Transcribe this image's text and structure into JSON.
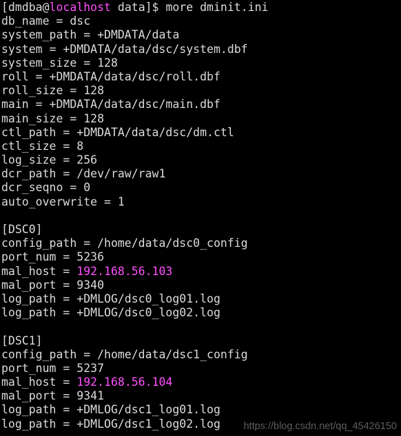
{
  "terminal": {
    "background_color": "#000000",
    "foreground_color": "#dcdcdc",
    "accent_color": "#ff50ff",
    "prompt": {
      "user_host_open": "[dmdba@",
      "host": "localhost",
      "path_close": " data]$ ",
      "command": "more dminit.ini"
    },
    "lines": [
      {
        "name": "prompt-line",
        "type": "prompt"
      },
      {
        "name": "line-db-name",
        "type": "plain",
        "text": "db_name = dsc"
      },
      {
        "name": "line-system-path",
        "type": "plain",
        "text": "system_path = +DMDATA/data"
      },
      {
        "name": "line-system",
        "type": "plain",
        "text": "system = +DMDATA/data/dsc/system.dbf"
      },
      {
        "name": "line-system-size",
        "type": "plain",
        "text": "system_size = 128"
      },
      {
        "name": "line-roll",
        "type": "plain",
        "text": "roll = +DMDATA/data/dsc/roll.dbf"
      },
      {
        "name": "line-roll-size",
        "type": "plain",
        "text": "roll_size = 128"
      },
      {
        "name": "line-main",
        "type": "plain",
        "text": "main = +DMDATA/data/dsc/main.dbf"
      },
      {
        "name": "line-main-size",
        "type": "plain",
        "text": "main_size = 128"
      },
      {
        "name": "line-ctl-path",
        "type": "plain",
        "text": "ctl_path = +DMDATA/data/dsc/dm.ctl"
      },
      {
        "name": "line-ctl-size",
        "type": "plain",
        "text": "ctl_size = 8"
      },
      {
        "name": "line-log-size",
        "type": "plain",
        "text": "log_size = 256"
      },
      {
        "name": "line-dcr-path",
        "type": "plain",
        "text": "dcr_path = /dev/raw/raw1"
      },
      {
        "name": "line-dcr-seqno",
        "type": "plain",
        "text": "dcr_seqno = 0"
      },
      {
        "name": "line-auto-overwrite",
        "type": "plain",
        "text": "auto_overwrite = 1"
      },
      {
        "name": "line-blank-1",
        "type": "blank",
        "text": ""
      },
      {
        "name": "section-header-dsc0",
        "type": "plain",
        "text": "[DSC0]"
      },
      {
        "name": "line-dsc0-config-path",
        "type": "plain",
        "text": "config_path = /home/data/dsc0_config"
      },
      {
        "name": "line-dsc0-port-num",
        "type": "plain",
        "text": "port_num = 5236"
      },
      {
        "name": "line-dsc0-mal-host",
        "type": "keyvalue",
        "prefix": "mal_host = ",
        "value": "192.168.56.103"
      },
      {
        "name": "line-dsc0-mal-port",
        "type": "plain",
        "text": "mal_port = 9340"
      },
      {
        "name": "line-dsc0-log-path-01",
        "type": "plain",
        "text": "log_path = +DMLOG/dsc0_log01.log"
      },
      {
        "name": "line-dsc0-log-path-02",
        "type": "plain",
        "text": "log_path = +DMLOG/dsc0_log02.log"
      },
      {
        "name": "line-blank-2",
        "type": "blank",
        "text": ""
      },
      {
        "name": "section-header-dsc1",
        "type": "plain",
        "text": "[DSC1]"
      },
      {
        "name": "line-dsc1-config-path",
        "type": "plain",
        "text": "config_path = /home/data/dsc1_config"
      },
      {
        "name": "line-dsc1-port-num",
        "type": "plain",
        "text": "port_num = 5237"
      },
      {
        "name": "line-dsc1-mal-host",
        "type": "keyvalue",
        "prefix": "mal_host = ",
        "value": "192.168.56.104"
      },
      {
        "name": "line-dsc1-mal-port",
        "type": "plain",
        "text": "mal_port = 9341"
      },
      {
        "name": "line-dsc1-log-path-01",
        "type": "plain",
        "text": "log_path = +DMLOG/dsc1_log01.log"
      },
      {
        "name": "line-dsc1-log-path-02",
        "type": "plain",
        "text": "log_path = +DMLOG/dsc1_log02.log"
      }
    ]
  },
  "watermark": {
    "text": "https://blog.csdn.net/qq_45426150"
  }
}
